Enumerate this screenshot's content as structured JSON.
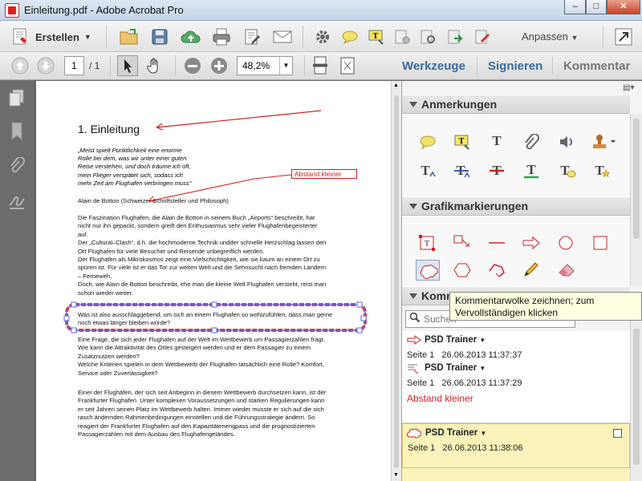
{
  "window": {
    "title": "Einleitung.pdf - Adobe Acrobat Pro",
    "minimize": "–",
    "maximize": "□",
    "close": "✕"
  },
  "toolbar": {
    "create_label": "Erstellen",
    "customize_label": "Anpassen",
    "page_current": "1",
    "page_total": "/ 1",
    "zoom": "48,2%"
  },
  "nav": {
    "tools": "Werkzeuge",
    "sign": "Signieren",
    "comment": "Kommentar"
  },
  "panel": {
    "annotations_title": "Anmerkungen",
    "graphics_title": "Grafikmarkierungen",
    "comments_title": "Kommentare",
    "search_placeholder": "Suchen",
    "tooltip": "Kommentarwolke zeichnen; zum Vervollständigen klicken"
  },
  "comments": [
    {
      "author": "PSD Trainer",
      "page": "Seite 1",
      "date": "26.06.2013 11:37:37",
      "text": "",
      "icon": "arrow-icon"
    },
    {
      "author": "PSD Trainer",
      "page": "Seite 1",
      "date": "26.06.2013 11:37:29",
      "text": "Abstand kleiner",
      "icon": "text-callout-icon"
    },
    {
      "author": "PSD Trainer",
      "page": "Seite 1",
      "date": "26.06.2013 11:38:06",
      "text": "",
      "icon": "cloud-icon"
    }
  ],
  "document": {
    "heading": "1. Einleitung",
    "quote": [
      "„Meist spielt Pünktlichkeit eine enorme",
      "Rolle bei dem, was wir unter einer guten",
      "Reise verstehen, und doch träume ich oft,",
      "mein Flieger verspätet sich, sodass ich",
      "mehr Zeit am Flughafen verbringen muss“"
    ],
    "author_line": "Alain de Botton (Schweizer Schriftsteller und Philosoph)",
    "para1": [
      "Die Faszination Flughafen, die Alain de Botton in seinem Buch „Airports“ beschreibt, hat",
      "nicht nur ihn gepackt, sondern greift den Enthusiasmus sehr vieler Flughafenbegeisterter",
      "auf.",
      "Der „Cultural–Clash“, d.h. die hochmoderne Technik undder schnelle Herzschlag lassen den",
      "Ort Flughafen für viele Besucher und Reisende unbegreiflich werden.",
      "Der Flughafen als Mikrokosmos zeigt eine Vielschichtigkeit, wie sie kaum an einem Ort zu",
      "spüren ist. Für viele ist er das Tor zur weiten Welt und die Sehnsucht nach fremden Ländern",
      "– Ferneweh.",
      "Doch, wie Alain de Botton beschreibt, ehe man die kleine Welt Flughafen versteht, reist man",
      "schon wieder weiter."
    ],
    "cloud_text": [
      "Was ist also ausschlaggebend, um sich an einem Flughafen so wohlzufühlen, dass man gerne",
      "noch etwas länger bleiben würde?"
    ],
    "para2": [
      "Eine Frage, die sich jeder Flughafen auf der Welt im Wettbewerb um Passagierzahlen fragt.",
      "Wie kann die Attraktivität des Ortes gesteigert werden und er dem Passagier zu einem",
      "Zusatznutzen werden?",
      "Welche Kriterien spielen in dem Wettbewerb der Flughäfen tatsächlich eine Rolle? Komfort,",
      "Service oder Zuverlässigkeit?"
    ],
    "para3": [
      "Einer der Flughäfen, der sich seit Anbeginn in diesem Wettbewerb durchsetzen kann, ist der",
      "Frankfurter Flughafen. Unter komplexen Voraussetzungen und starken Regulierungen kann",
      "er seit Jahren seinen Platz im Wettbewerb halten. Immer wieder musste er sich auf die sich",
      "rasch ändernden Rahmenbedingungen einstellen und die Führungsstrategie ändern.  So",
      "reagiert der Frankfurter Flughafen auf den Kapazitätenengpass und die prognostizierten",
      "Passagierzahlen mit dem Ausbau des Flughafengeländes."
    ],
    "callout_label": "Abstand kleiner"
  },
  "colors": {
    "accent": "#3d6a9a",
    "markup_red": "#d02020",
    "comment_selected": "#fbf3b9"
  }
}
